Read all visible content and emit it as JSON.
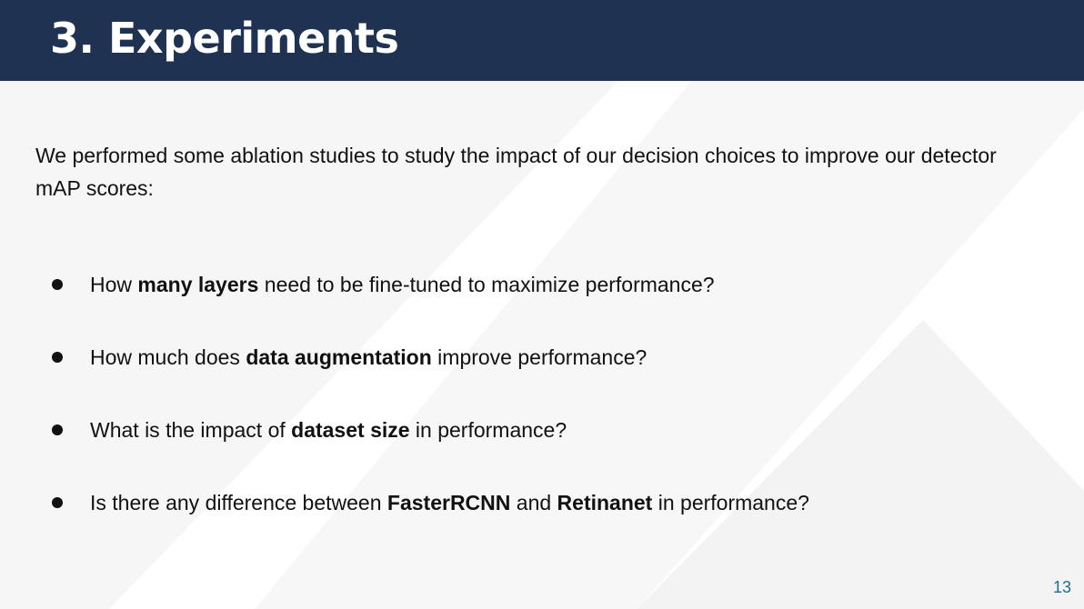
{
  "slide": {
    "title": "3. Experiments",
    "intro": "We performed some ablation studies to study the impact of our decision choices to improve our detector mAP scores:",
    "page_number": "13",
    "colors": {
      "header": "#1f3251",
      "page_number": "#1f6f8b"
    }
  },
  "bullets": [
    {
      "parts": [
        "How ",
        "many layers",
        " need to be fine-tuned to maximize performance?"
      ]
    },
    {
      "parts": [
        "How much does ",
        "data augmentation",
        " improve performance?"
      ]
    },
    {
      "parts": [
        "What is the impact of ",
        "dataset size",
        " in performance?"
      ]
    },
    {
      "parts": [
        "Is there any difference between ",
        "FasterRCNN",
        " and ",
        "Retinanet",
        " in performance?"
      ]
    }
  ]
}
